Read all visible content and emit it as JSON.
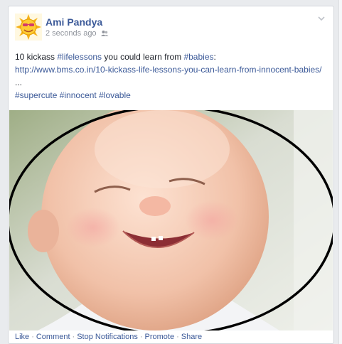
{
  "post": {
    "author": "Ami Pandya",
    "timestamp": "2 seconds ago",
    "privacy_icon": "friends-icon",
    "text_intro": "10 kickass ",
    "hashtag_lifelessons": "#lifelessons",
    "text_mid": " you could learn from ",
    "hashtag_babies": "#babies",
    "text_colon": ":",
    "link": "http://www.bms.co.in/10-kickass-life-lessons-you-can-learn-from-innocent-babies/",
    "ellipsis": " ...",
    "hashtag_supercute": "#supercute",
    "hashtag_innocent": "#innocent",
    "hashtag_lovable": "#lovable"
  },
  "actions": {
    "like": "Like",
    "comment": "Comment",
    "stop_notifications": "Stop Notifications",
    "promote": "Promote",
    "share": "Share",
    "separator": "·"
  },
  "colors": {
    "link_blue": "#3b5998",
    "meta_gray": "#90949c",
    "annotation_ellipse": "#000000"
  }
}
